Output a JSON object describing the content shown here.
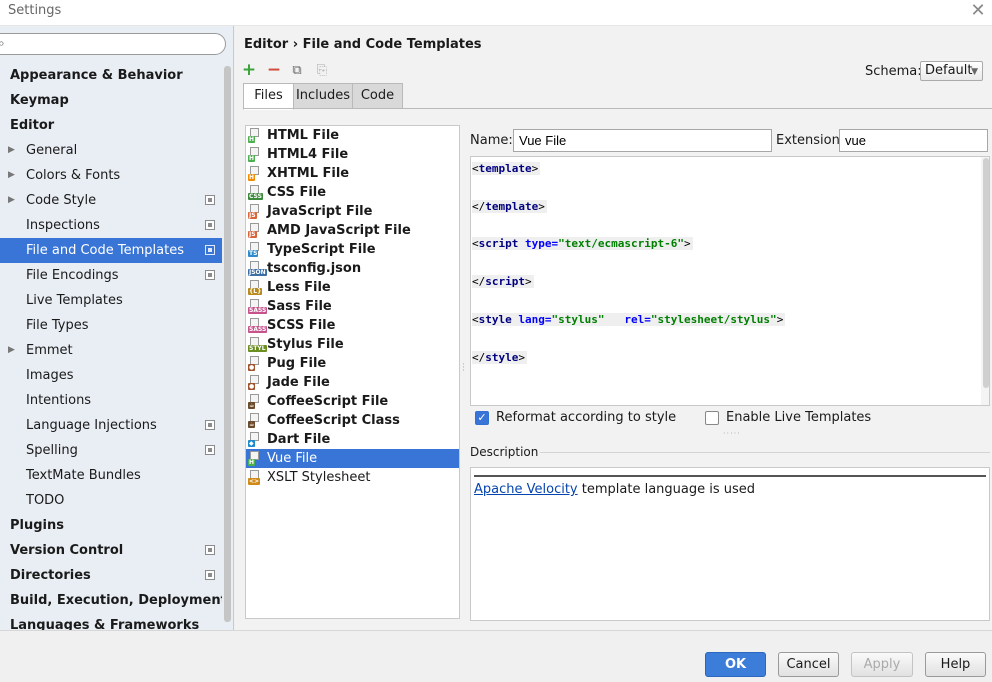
{
  "window": {
    "title": "Settings",
    "close_glyph": "✕"
  },
  "sidebar": {
    "search_value": "",
    "items": [
      {
        "label": "Appearance & Behavior",
        "level": 0,
        "arrow": false,
        "project": false,
        "selected": false
      },
      {
        "label": "Keymap",
        "level": 0,
        "arrow": false,
        "project": false,
        "selected": false
      },
      {
        "label": "Editor",
        "level": 0,
        "arrow": false,
        "project": false,
        "selected": false
      },
      {
        "label": "General",
        "level": 1,
        "arrow": true,
        "project": false,
        "selected": false
      },
      {
        "label": "Colors & Fonts",
        "level": 1,
        "arrow": true,
        "project": false,
        "selected": false
      },
      {
        "label": "Code Style",
        "level": 1,
        "arrow": true,
        "project": true,
        "selected": false
      },
      {
        "label": "Inspections",
        "level": 1,
        "arrow": false,
        "project": true,
        "selected": false
      },
      {
        "label": "File and Code Templates",
        "level": 1,
        "arrow": false,
        "project": true,
        "selected": true
      },
      {
        "label": "File Encodings",
        "level": 1,
        "arrow": false,
        "project": true,
        "selected": false
      },
      {
        "label": "Live Templates",
        "level": 1,
        "arrow": false,
        "project": false,
        "selected": false
      },
      {
        "label": "File Types",
        "level": 1,
        "arrow": false,
        "project": false,
        "selected": false
      },
      {
        "label": "Emmet",
        "level": 1,
        "arrow": true,
        "project": false,
        "selected": false
      },
      {
        "label": "Images",
        "level": 1,
        "arrow": false,
        "project": false,
        "selected": false
      },
      {
        "label": "Intentions",
        "level": 1,
        "arrow": false,
        "project": false,
        "selected": false
      },
      {
        "label": "Language Injections",
        "level": 1,
        "arrow": false,
        "project": true,
        "selected": false
      },
      {
        "label": "Spelling",
        "level": 1,
        "arrow": false,
        "project": true,
        "selected": false
      },
      {
        "label": "TextMate Bundles",
        "level": 1,
        "arrow": false,
        "project": false,
        "selected": false
      },
      {
        "label": "TODO",
        "level": 1,
        "arrow": false,
        "project": false,
        "selected": false
      },
      {
        "label": "Plugins",
        "level": 0,
        "arrow": false,
        "project": false,
        "selected": false
      },
      {
        "label": "Version Control",
        "level": 0,
        "arrow": false,
        "project": true,
        "selected": false
      },
      {
        "label": "Directories",
        "level": 0,
        "arrow": false,
        "project": true,
        "selected": false
      },
      {
        "label": "Build, Execution, Deployment",
        "level": 0,
        "arrow": false,
        "project": false,
        "selected": false
      },
      {
        "label": "Languages & Frameworks",
        "level": 0,
        "arrow": false,
        "project": false,
        "selected": false
      }
    ]
  },
  "header": {
    "breadcrumb_parent": "Editor",
    "breadcrumb_sep": "›",
    "breadcrumb_current": "File and Code Templates",
    "schema_label": "Schema:",
    "schema_value": "Default"
  },
  "toolbar": {
    "add_glyph": "+",
    "remove_glyph": "−",
    "copy_glyph": "⧉",
    "reset_glyph": "⎘"
  },
  "tabs": [
    {
      "label": "Files",
      "active": true
    },
    {
      "label": "Includes",
      "active": false
    },
    {
      "label": "Code",
      "active": false
    }
  ],
  "files": [
    {
      "label": "HTML File",
      "tag": "H",
      "color": "#4caf50",
      "bold": true
    },
    {
      "label": "HTML4 File",
      "tag": "H",
      "color": "#4caf50",
      "bold": true
    },
    {
      "label": "XHTML File",
      "tag": "H",
      "color": "#f08c00",
      "bold": true
    },
    {
      "label": "CSS File",
      "tag": "CSS",
      "color": "#3a8a3a",
      "bold": true
    },
    {
      "label": "JavaScript File",
      "tag": "JS",
      "color": "#d9653b",
      "bold": true
    },
    {
      "label": "AMD JavaScript File",
      "tag": "JS",
      "color": "#d9653b",
      "bold": true
    },
    {
      "label": "TypeScript File",
      "tag": "TS",
      "color": "#2f8bc9",
      "bold": true
    },
    {
      "label": "tsconfig.json",
      "tag": "JSON",
      "color": "#3a6ea5",
      "bold": true
    },
    {
      "label": "Less File",
      "tag": "{L}",
      "color": "#b88a1e",
      "bold": true
    },
    {
      "label": "Sass File",
      "tag": "SASS",
      "color": "#c6538c",
      "bold": true
    },
    {
      "label": "SCSS File",
      "tag": "SASS",
      "color": "#c6538c",
      "bold": true
    },
    {
      "label": "Stylus File",
      "tag": "STYL",
      "color": "#6b8e23",
      "bold": true
    },
    {
      "label": "Pug File",
      "tag": "●",
      "color": "#a0522d",
      "bold": true
    },
    {
      "label": "Jade File",
      "tag": "●",
      "color": "#a0522d",
      "bold": true
    },
    {
      "label": "CoffeeScript File",
      "tag": "☕",
      "color": "#6b4a2b",
      "bold": true
    },
    {
      "label": "CoffeeScript Class",
      "tag": "☕",
      "color": "#6b4a2b",
      "bold": true
    },
    {
      "label": "Dart File",
      "tag": "◆",
      "color": "#1d8acb",
      "bold": true
    },
    {
      "label": "Vue File",
      "tag": "H",
      "color": "#4caf50",
      "bold": false,
      "selected": true
    },
    {
      "label": "XSLT Stylesheet",
      "tag": "<>",
      "color": "#d08a1a",
      "bold": false
    }
  ],
  "template": {
    "name_label": "Name:",
    "name_value": "Vue File",
    "ext_label": "Extension:",
    "ext_value": "vue",
    "code": {
      "l1_open": "<",
      "l1_tag": "template",
      "l1_close": ">",
      "l2_open": "</",
      "l2_tag": "template",
      "l2_close": ">",
      "l3_open": "<",
      "l3_tag": "script",
      "l3_attr": " type=",
      "l3_val": "\"text/ecmascript-6\"",
      "l3_close": ">",
      "l4_open": "</",
      "l4_tag": "script",
      "l4_close": ">",
      "l5_open": "<",
      "l5_tag": "style",
      "l5_attr1": " lang=",
      "l5_val1": "\"stylus\"",
      "l5_attr2": "   rel=",
      "l5_val2": "\"stylesheet/stylus\"",
      "l5_close": ">",
      "l6_open": "</",
      "l6_tag": "style",
      "l6_close": ">"
    },
    "reformat_label": "Reformat according to style",
    "reformat_checked": true,
    "live_label": "Enable Live Templates",
    "live_checked": false
  },
  "description": {
    "label": "Description",
    "link_text": "Apache Velocity",
    "text": " template language is used"
  },
  "footer": {
    "ok": "OK",
    "cancel": "Cancel",
    "apply": "Apply",
    "help": "Help"
  }
}
